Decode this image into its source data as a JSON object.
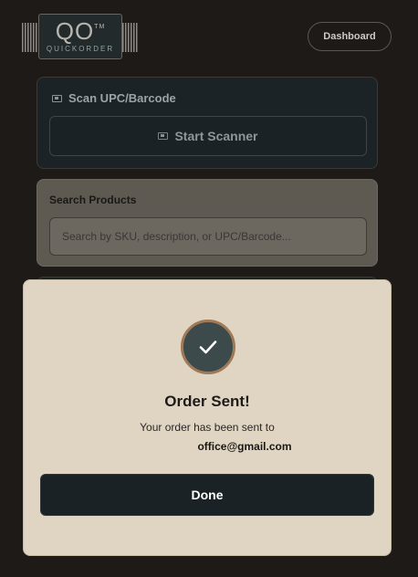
{
  "header": {
    "logo_mark": "QO",
    "logo_tm": "TM",
    "logo_sub": "QUICKORDER",
    "dashboard_label": "Dashboard"
  },
  "scan": {
    "title": "Scan UPC/Barcode",
    "button_label": "Start Scanner",
    "icon": "camera-icon"
  },
  "search": {
    "title": "Search Products",
    "placeholder": "Search by SKU, description, or UPC/Barcode..."
  },
  "modal": {
    "icon": "checkmark-icon",
    "title": "Order Sent!",
    "message": "Your order has been sent to",
    "email": "office@gmail.com",
    "done_label": "Done"
  },
  "colors": {
    "background": "#1d1a18",
    "modal_bg": "#dfd5c2",
    "dark_button": "#1b2225",
    "check_circle": "#3c4a4c",
    "check_ring": "#a07a56"
  }
}
